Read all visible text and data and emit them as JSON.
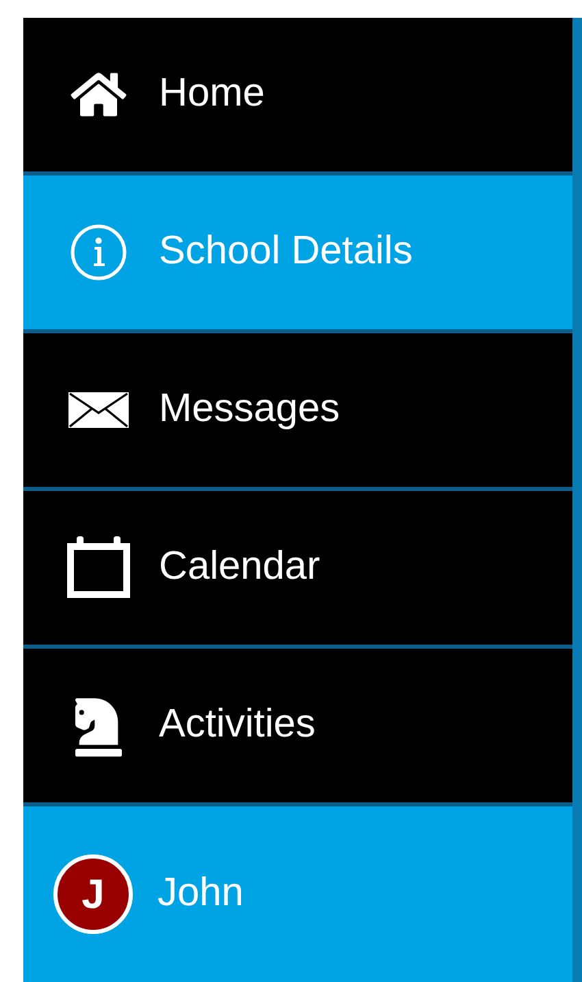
{
  "nav": {
    "items": [
      {
        "label": "Home",
        "selected": false
      },
      {
        "label": "School Details",
        "selected": true
      },
      {
        "label": "Messages",
        "selected": false
      },
      {
        "label": "Calendar",
        "selected": false
      },
      {
        "label": "Activities",
        "selected": false
      }
    ]
  },
  "user": {
    "initial": "J",
    "name": "John"
  }
}
